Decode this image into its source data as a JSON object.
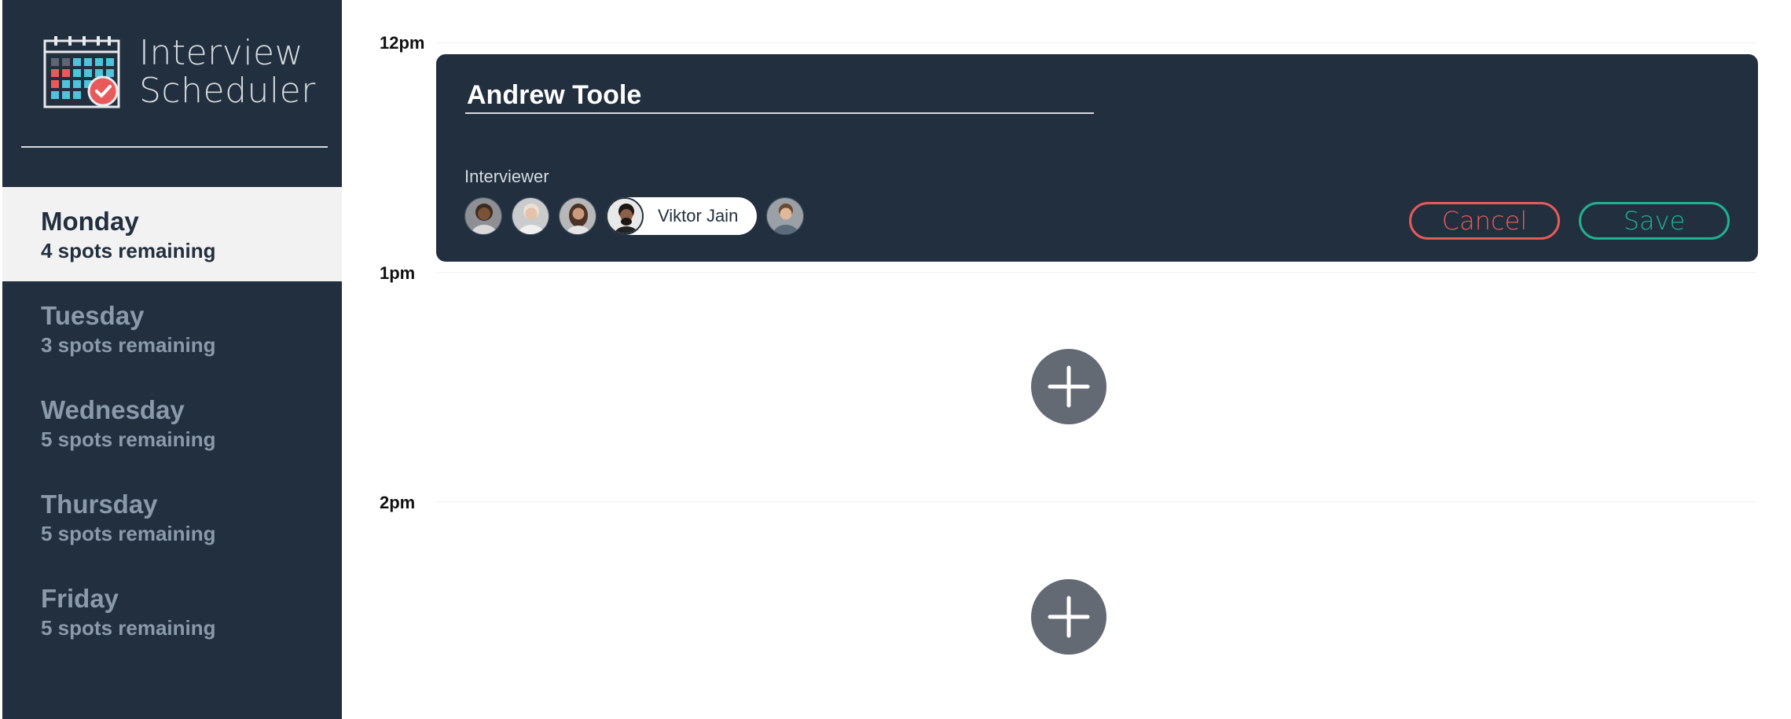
{
  "app": {
    "title_line1": "Interview",
    "title_line2": "Scheduler"
  },
  "days": [
    {
      "name": "Monday",
      "spots": "4 spots remaining",
      "selected": true
    },
    {
      "name": "Tuesday",
      "spots": "3 spots remaining",
      "selected": false
    },
    {
      "name": "Wednesday",
      "spots": "5 spots remaining",
      "selected": false
    },
    {
      "name": "Thursday",
      "spots": "5 spots remaining",
      "selected": false
    },
    {
      "name": "Friday",
      "spots": "5 spots remaining",
      "selected": false
    }
  ],
  "times": [
    "12pm",
    "1pm",
    "2pm"
  ],
  "editor": {
    "student_name": "Andrew Toole",
    "interviewer_label": "Interviewer",
    "selected_interviewer": "Viktor Jain",
    "cancel_label": "Cancel",
    "save_label": "Save"
  },
  "colors": {
    "sidebar_bg": "#222f3e",
    "cancel": "#e85a5a",
    "save": "#20b190",
    "add_button": "#636a74"
  },
  "icons": {
    "logo": "calendar-check-icon",
    "add": "plus-icon"
  }
}
